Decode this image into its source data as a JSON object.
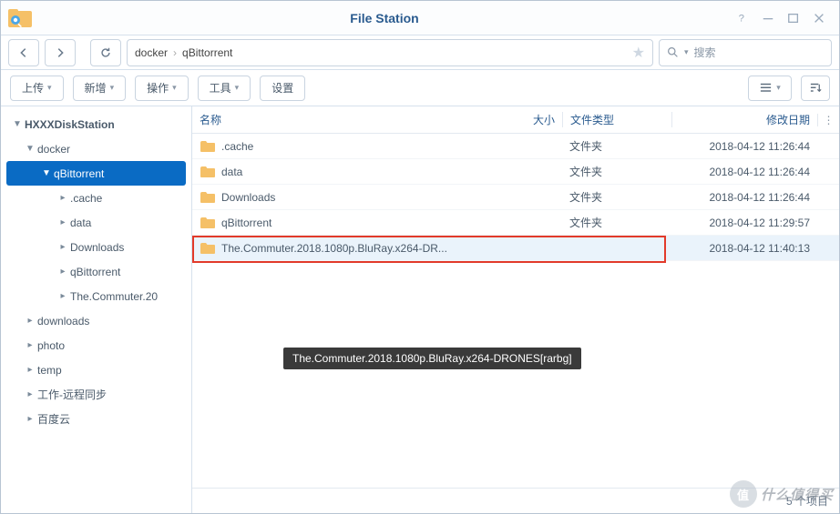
{
  "window": {
    "title": "File Station"
  },
  "breadcrumb": [
    "docker",
    "qBittorrent"
  ],
  "search": {
    "placeholder": "搜索"
  },
  "toolbar": {
    "upload": "上传",
    "new": "新增",
    "action": "操作",
    "tools": "工具",
    "settings": "设置"
  },
  "tree": {
    "root": "HXXXDiskStation",
    "items": [
      {
        "label": "docker",
        "depth": 1,
        "expanded": true
      },
      {
        "label": "qBittorrent",
        "depth": 2,
        "expanded": true,
        "selected": true
      },
      {
        "label": ".cache",
        "depth": 3
      },
      {
        "label": "data",
        "depth": 3
      },
      {
        "label": "Downloads",
        "depth": 3
      },
      {
        "label": "qBittorrent",
        "depth": 3
      },
      {
        "label": "The.Commuter.20",
        "depth": 3
      },
      {
        "label": "downloads",
        "depth": 1
      },
      {
        "label": "photo",
        "depth": 1
      },
      {
        "label": "temp",
        "depth": 1
      },
      {
        "label": "工作-远程同步",
        "depth": 1
      },
      {
        "label": "百度云",
        "depth": 1
      }
    ]
  },
  "columns": {
    "name": "名称",
    "size": "大小",
    "type": "文件类型",
    "date": "修改日期"
  },
  "files": [
    {
      "name": ".cache",
      "size": "",
      "type": "文件夹",
      "date": "2018-04-12 11:26:44"
    },
    {
      "name": "data",
      "size": "",
      "type": "文件夹",
      "date": "2018-04-12 11:26:44"
    },
    {
      "name": "Downloads",
      "size": "",
      "type": "文件夹",
      "date": "2018-04-12 11:26:44"
    },
    {
      "name": "qBittorrent",
      "size": "",
      "type": "文件夹",
      "date": "2018-04-12 11:29:57"
    },
    {
      "name": "The.Commuter.2018.1080p.BluRay.x264-DR...",
      "size": "",
      "type": "",
      "date": "2018-04-12 11:40:13",
      "selected": true,
      "highlighted": true
    }
  ],
  "tooltip": "The.Commuter.2018.1080p.BluRay.x264-DRONES[rarbg]",
  "status": {
    "count": "5 个项目"
  },
  "watermark": "什么值得买"
}
